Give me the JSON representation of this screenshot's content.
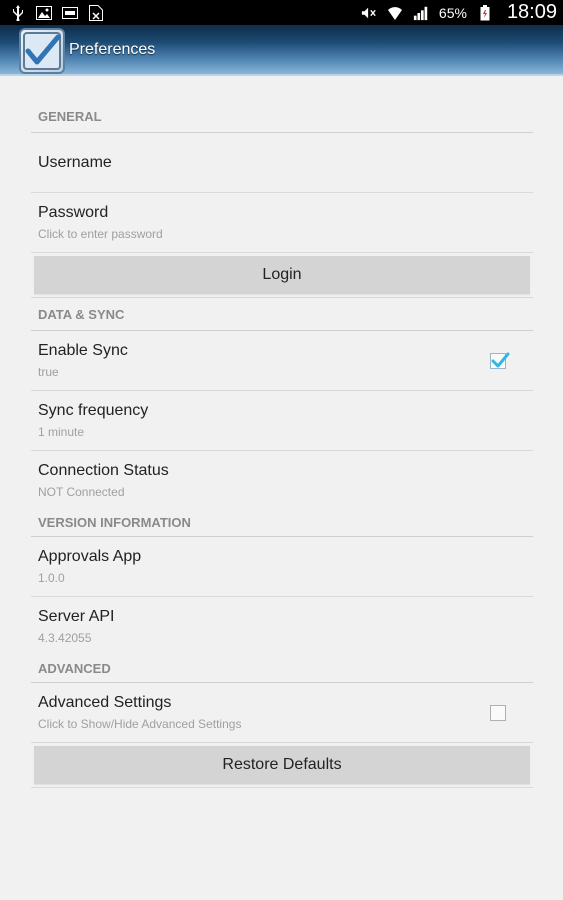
{
  "status_bar": {
    "icons_left": [
      "usb-icon",
      "image-icon",
      "keyboard-icon",
      "file-icon"
    ],
    "icons_right": [
      "mute-icon",
      "wifi-icon",
      "signal-icon"
    ],
    "battery_pct": "65%",
    "time": "18:09"
  },
  "action_bar": {
    "title": "Preferences",
    "icon": "checkmark-app-icon",
    "color_dark": "#0e2d49",
    "color_light": "#8ab6da"
  },
  "sections": {
    "general": {
      "header": "GENERAL",
      "username": {
        "title": "Username"
      },
      "password": {
        "title": "Password",
        "summary": "Click to enter password"
      },
      "login_button": "Login"
    },
    "data_sync": {
      "header": "DATA & SYNC",
      "enable_sync": {
        "title": "Enable Sync",
        "summary": "true",
        "checked": true
      },
      "sync_frequency": {
        "title": "Sync frequency",
        "summary": "1 minute"
      },
      "connection_status": {
        "title": "Connection Status",
        "summary": "NOT Connected"
      }
    },
    "version": {
      "header": "VERSION INFORMATION",
      "approvals_app": {
        "title": "Approvals App",
        "summary": "1.0.0"
      },
      "server_api": {
        "title": "Server API",
        "summary": "4.3.42055"
      }
    },
    "advanced": {
      "header": "ADVANCED",
      "advanced_settings": {
        "title": "Advanced Settings",
        "summary": "Click to Show/Hide Advanced Settings",
        "checked": false
      },
      "restore_button": "Restore Defaults"
    }
  },
  "colors": {
    "background": "#f1f1f1",
    "button_bg": "#d4d4d4",
    "checkbox_accent": "#33b5e5",
    "header_text": "#8a8a8a"
  }
}
